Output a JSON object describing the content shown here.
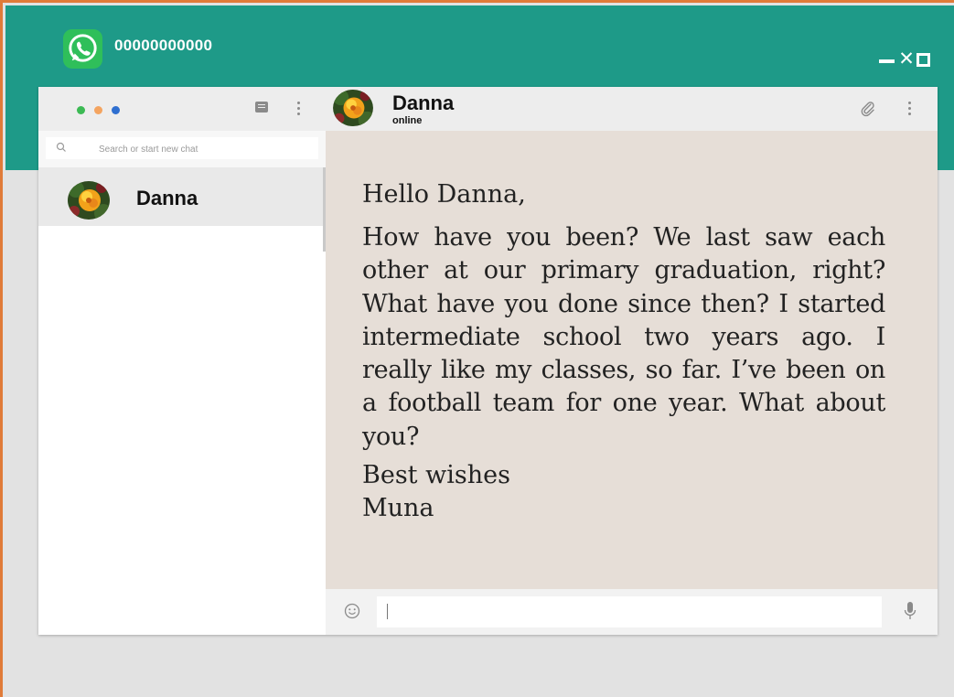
{
  "window": {
    "phone_number": "00000000000",
    "controls": {
      "minimize_icon": "minimize-icon",
      "close_icon": "close-icon",
      "maximize_icon": "maximize-icon"
    }
  },
  "colors": {
    "brand_teal": "#1e9a88",
    "frame_accent": "#e07b39",
    "conversation_bg": "#e6ded7",
    "dot_green": "#3cba54",
    "dot_orange": "#f4a460",
    "dot_blue": "#2f6fd0"
  },
  "sidebar": {
    "search_placeholder": "Search or start new chat",
    "chats": [
      {
        "name": "Danna",
        "active": true
      }
    ]
  },
  "conversation": {
    "contact_name": "Danna",
    "contact_status": "online",
    "message": {
      "greeting": "Hello Danna,",
      "body": "How have you been? We last saw each other at our primary graduation, right? What have you done since then? I started intermediate school two years ago. I really like my classes, so far. I’ve been on a football team for one year. What about you?",
      "closing": "Best wishes",
      "signature": "Muna"
    }
  },
  "composer": {
    "input_value": ""
  }
}
